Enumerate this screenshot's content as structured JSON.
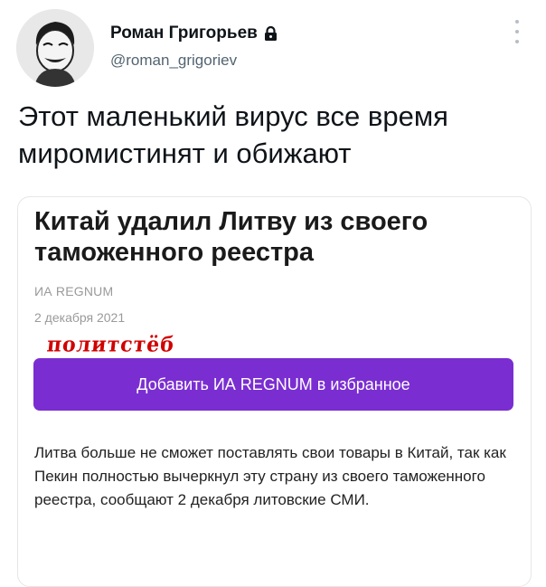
{
  "tweet": {
    "author_name": "Роман Григорьев",
    "author_handle": "@roman_grigoriev",
    "text": "Этот маленький вирус все время миромистинят и обижают",
    "icons": {
      "lock": "lock-icon",
      "more": "more-vertical-icon",
      "avatar": "avatar-image"
    }
  },
  "card": {
    "title": "Китай удалил Литву из своего таможенного реестра",
    "source": "ИА REGNUM",
    "date": "2 декабря 2021",
    "watermark": "политстёб",
    "button_label": "Добавить ИА REGNUM в избранное",
    "body": "Литва больше не сможет поставлять свои товары в Китай, так как Пекин полностью вычеркнул эту страну из своего таможенного реестра, сообщают 2 декабря литовские СМИ."
  },
  "colors": {
    "accent": "#7a2ed1",
    "watermark": "#d10000",
    "muted": "#9a9a9a"
  }
}
